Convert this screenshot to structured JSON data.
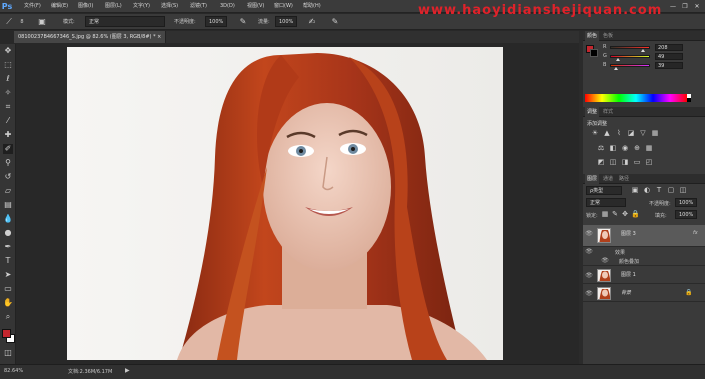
{
  "app": {
    "logo": "Ps"
  },
  "menu": [
    "文件(F)",
    "编辑(E)",
    "图像(I)",
    "图层(L)",
    "文字(Y)",
    "选择(S)",
    "滤镜(T)",
    "3D(D)",
    "视图(V)",
    "窗口(W)",
    "帮助(H)"
  ],
  "window_controls": [
    "—",
    "❐",
    "✕"
  ],
  "watermark": "www.haoyidianshejiquan.com",
  "options": {
    "mode_label": "模式:",
    "mode_value": "正常",
    "opacity_label": "不透明度:",
    "opacity_value": "100%",
    "flow_label": "流量:",
    "flow_value": "100%",
    "brush_size": "8"
  },
  "document_tab": "08100237B4667346_S.jpg @ 82.6% (图层 3, RGB/8#) *",
  "toolbar_tools": [
    "move-icon",
    "marquee-icon",
    "lasso-icon",
    "quick-select-icon",
    "crop-icon",
    "eyedropper-icon",
    "healing-icon",
    "brush-icon",
    "clone-stamp-icon",
    "history-brush-icon",
    "eraser-icon",
    "gradient-icon",
    "blur-icon",
    "dodge-icon",
    "pen-icon",
    "type-icon",
    "path-select-icon",
    "shape-icon",
    "hand-icon",
    "zoom-icon"
  ],
  "colors": {
    "foreground": "#c3262e",
    "background": "#ffffff",
    "accent": "#e0222a"
  },
  "status": {
    "zoom": "82.64%",
    "doc_size": "文档:2.36M/6.17M"
  },
  "color_panel": {
    "tabs": [
      "颜色",
      "色板"
    ],
    "r_label": "R",
    "r_value": "208",
    "g_label": "G",
    "g_value": "49",
    "b_label": "B",
    "b_value": "39",
    "r": 208,
    "g": 49,
    "b": 39
  },
  "adjust_panel": {
    "tabs": [
      "调整",
      "样式"
    ],
    "title": "添加调整"
  },
  "layers_panel": {
    "tabs": [
      "图层",
      "通道",
      "路径"
    ],
    "filter_label": "ρ类型",
    "blend_mode": "正常",
    "opacity_label": "不透明度:",
    "opacity_value": "100%",
    "lock_label": "锁定:",
    "fill_label": "填充:",
    "fill_value": "100%",
    "fx_badge": "fx",
    "effects_label": "效果",
    "effect_item": "颜色叠加",
    "layers": [
      {
        "name": "图层 3",
        "selected": true
      },
      {
        "name": "图层 1",
        "selected": false
      },
      {
        "name": "背景",
        "selected": false
      }
    ],
    "lock_icon": "🔒"
  }
}
